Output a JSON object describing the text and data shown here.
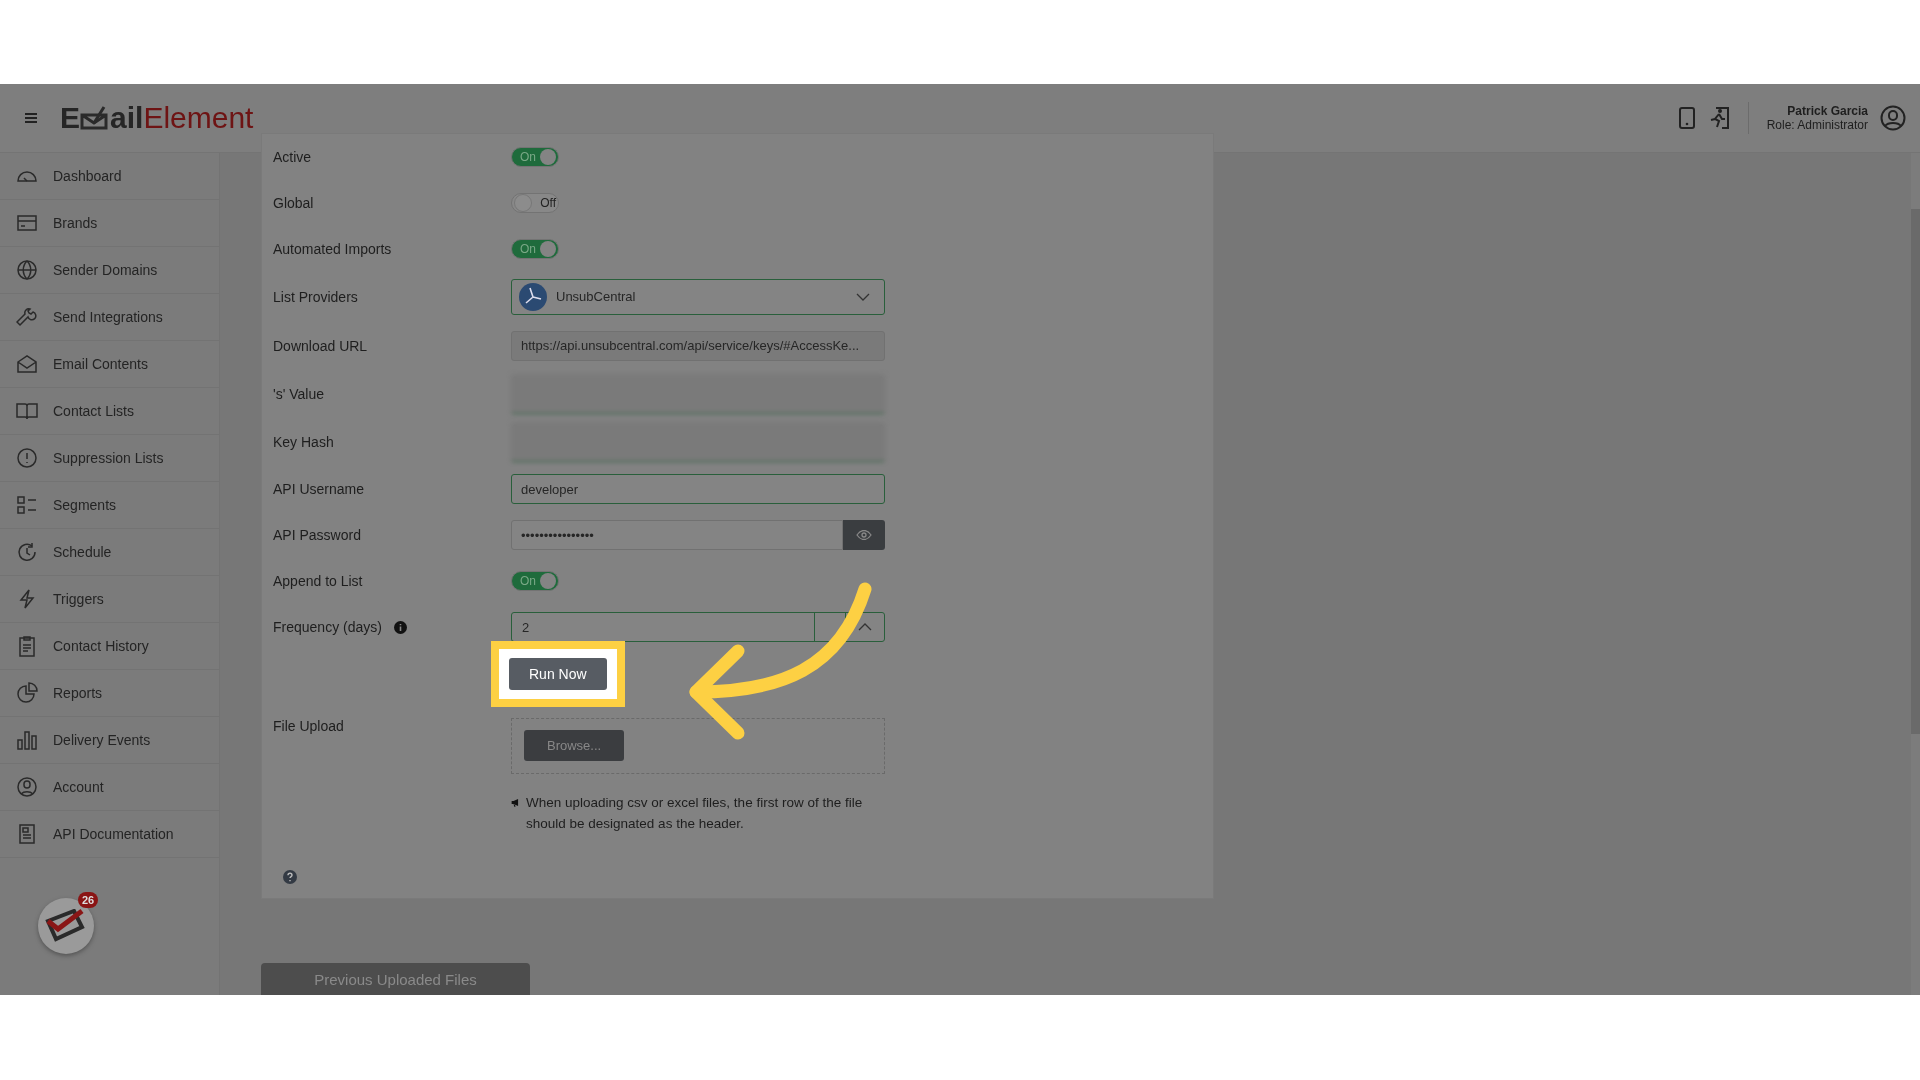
{
  "header": {
    "logo": {
      "dark_before": "E",
      "dark_after": "ail",
      "accent": "Element"
    },
    "user": {
      "name": "Patrick Garcia",
      "role": "Role: Administrator"
    }
  },
  "sidebar": {
    "items": [
      {
        "label": "Dashboard"
      },
      {
        "label": "Brands"
      },
      {
        "label": "Sender Domains"
      },
      {
        "label": "Send Integrations"
      },
      {
        "label": "Email Contents"
      },
      {
        "label": "Contact Lists"
      },
      {
        "label": "Suppression Lists"
      },
      {
        "label": "Segments"
      },
      {
        "label": "Schedule"
      },
      {
        "label": "Triggers"
      },
      {
        "label": "Contact History"
      },
      {
        "label": "Reports"
      },
      {
        "label": "Delivery Events"
      },
      {
        "label": "Account"
      },
      {
        "label": "API Documentation"
      }
    ],
    "badge": "26"
  },
  "form": {
    "fields": [
      {
        "kind": "toggle",
        "label": "Active",
        "on": true,
        "toggle_text": "On"
      },
      {
        "kind": "toggle",
        "label": "Global",
        "on": false,
        "toggle_text": "Off"
      },
      {
        "kind": "toggle",
        "label": "Automated Imports",
        "on": true,
        "toggle_text": "On"
      },
      {
        "kind": "select",
        "label": "List Providers",
        "value": "UnsubCentral"
      },
      {
        "kind": "readonly",
        "label": "Download URL",
        "value": "https://api.unsubcentral.com/api/service/keys/#AccessKe..."
      },
      {
        "kind": "blurred",
        "label": "'s' Value"
      },
      {
        "kind": "blurred",
        "label": "Key Hash"
      },
      {
        "kind": "text",
        "label": "API Username",
        "value": "developer"
      },
      {
        "kind": "password",
        "label": "API Password",
        "value": "••••••••••••••••"
      },
      {
        "kind": "toggle",
        "label": "Append to List",
        "on": true,
        "toggle_text": "On"
      },
      {
        "kind": "number",
        "label": "Frequency (days)",
        "value": "2"
      }
    ],
    "run_button": "Run Now",
    "upload": {
      "label": "File Upload",
      "browse": "Browse...",
      "note": "When uploading csv or excel files, the first row of the file should be designated as the header."
    }
  },
  "previous_files_button": "Previous Uploaded Files"
}
